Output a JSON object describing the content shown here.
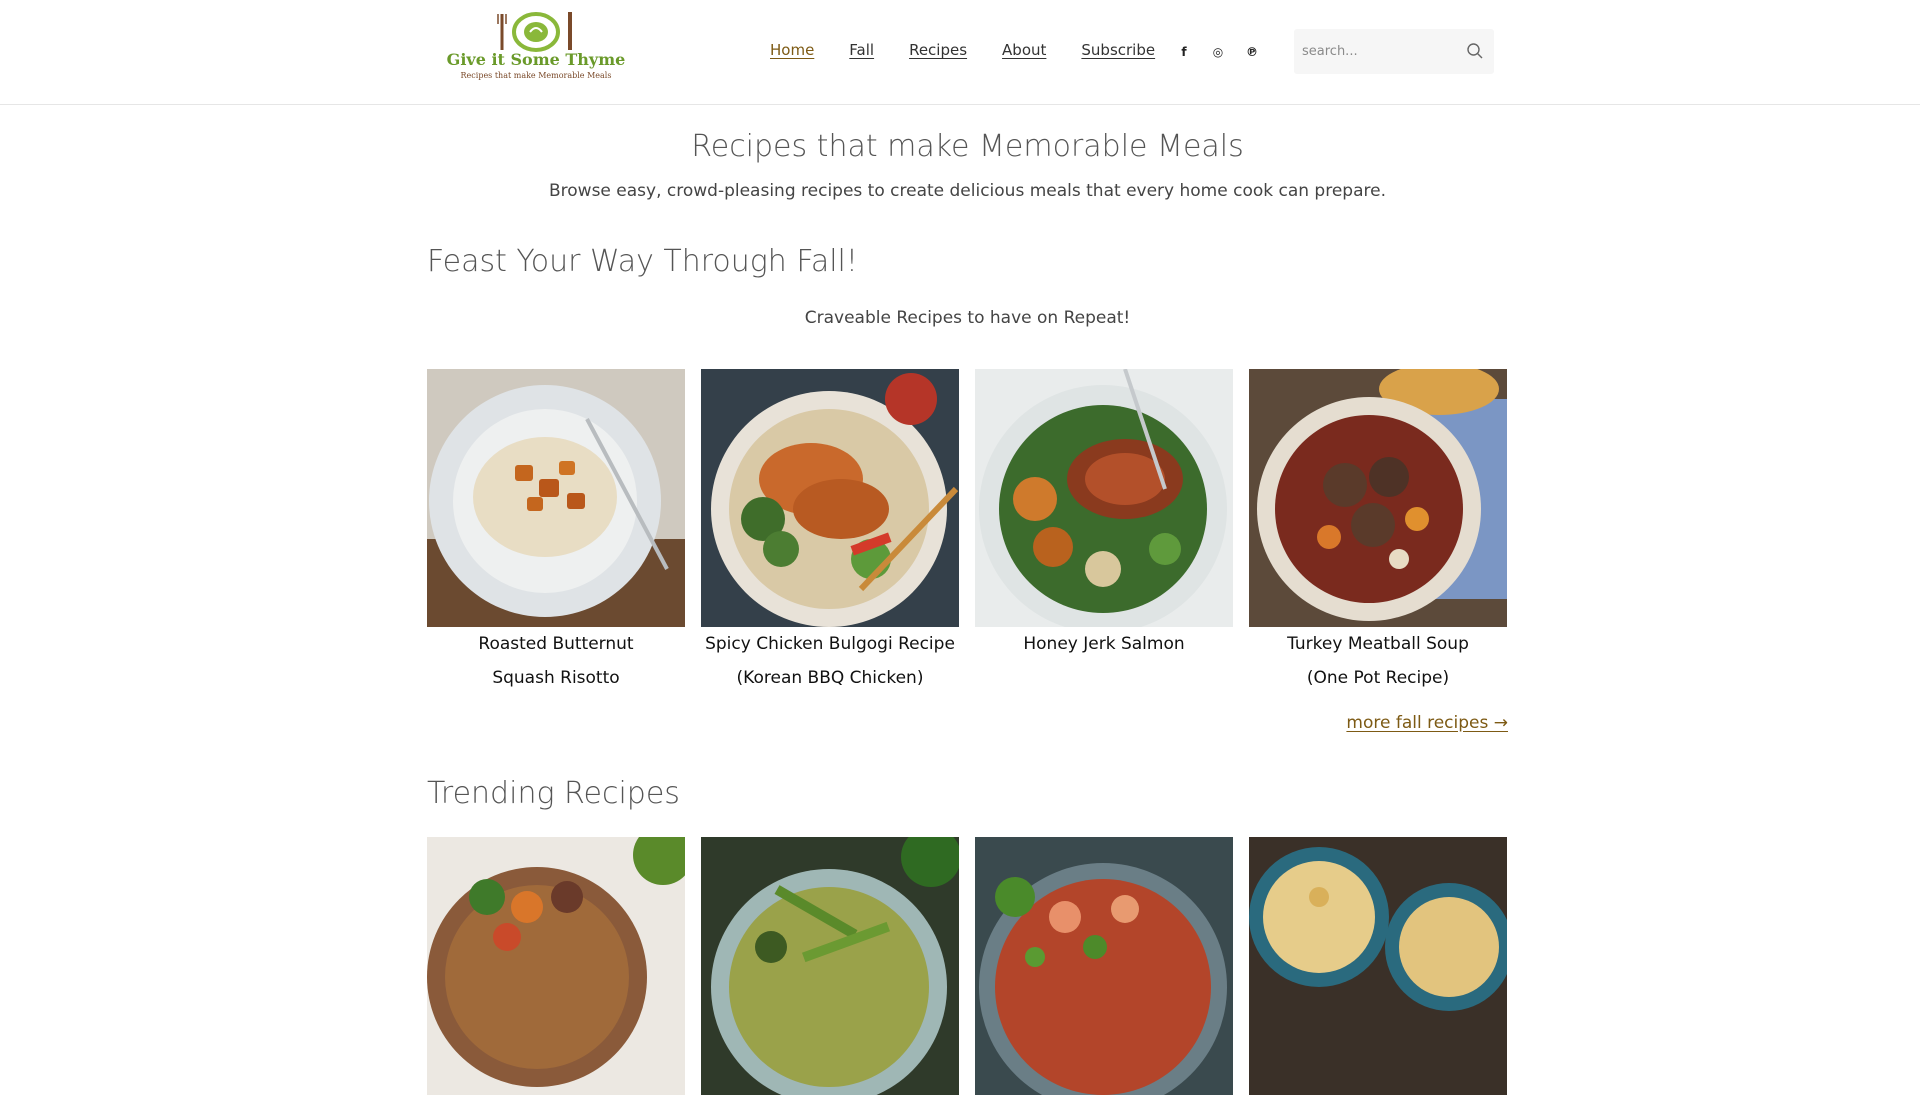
{
  "header": {
    "logo": {
      "name": "Give it Some Thyme",
      "tagline": "Recipes that make Memorable Meals"
    },
    "nav": [
      {
        "label": "Home",
        "active": true
      },
      {
        "label": "Fall",
        "active": false
      },
      {
        "label": "Recipes",
        "active": false
      },
      {
        "label": "About",
        "active": false
      },
      {
        "label": "Subscribe",
        "active": false
      }
    ],
    "social": [
      {
        "icon": "facebook-icon",
        "glyph": "f"
      },
      {
        "icon": "instagram-icon",
        "glyph": "◎"
      },
      {
        "icon": "pinterest-icon",
        "glyph": "℗"
      }
    ],
    "search": {
      "placeholder": "search...",
      "value": ""
    }
  },
  "hero": {
    "title": "Recipes that make Memorable Meals",
    "subtitle": "Browse easy, crowd-pleasing recipes to create delicious meals that every home cook can prepare."
  },
  "fall": {
    "title": "Feast Your Way Through Fall!",
    "subtitle": "Craveable Recipes to have on Repeat!",
    "cards": [
      {
        "title": "Roasted Butternut Squash Risotto",
        "line1": "Roasted Butternut",
        "line2": "Squash Risotto"
      },
      {
        "title": "Spicy Chicken Bulgogi Recipe (Korean BBQ Chicken)",
        "line1": "Spicy Chicken Bulgogi Recipe",
        "line2": "(Korean BBQ Chicken)"
      },
      {
        "title": "Honey Jerk Salmon",
        "line1": "Honey Jerk Salmon",
        "line2": ""
      },
      {
        "title": "Turkey Meatball Soup (One Pot Recipe)",
        "line1": "Turkey Meatball Soup",
        "line2": "(One Pot Recipe)"
      }
    ],
    "more_link": "more fall recipes →"
  },
  "trending": {
    "title": "Trending Recipes",
    "cards": [
      {
        "image": "roasted-vegetables-image"
      },
      {
        "image": "green-bean-pasta-image"
      },
      {
        "image": "shrimp-jambalaya-image"
      },
      {
        "image": "shepherds-pie-image"
      }
    ]
  },
  "colors": {
    "accent": "#7d5a14",
    "logo_green": "#6a9a2a",
    "text": "#333333",
    "search_bg": "#f6f6f6"
  }
}
